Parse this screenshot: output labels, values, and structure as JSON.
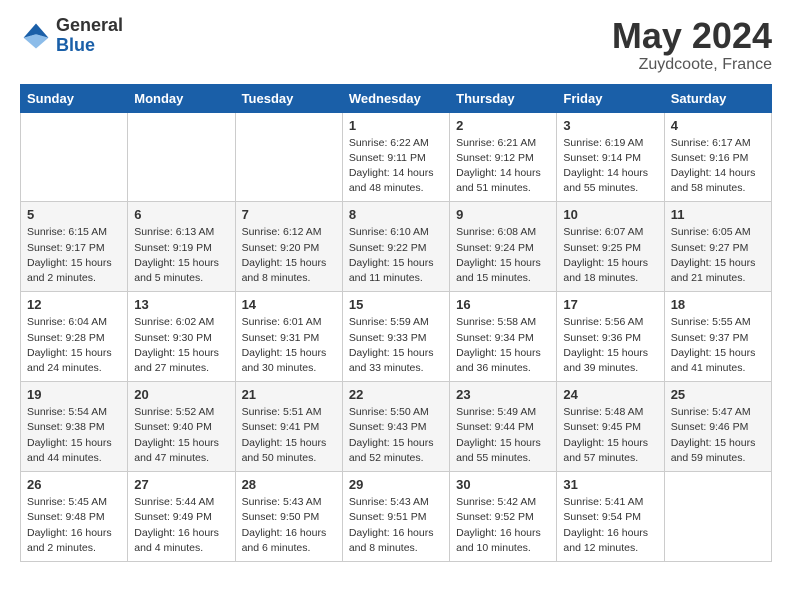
{
  "logo": {
    "general": "General",
    "blue": "Blue"
  },
  "header": {
    "title": "May 2024",
    "location": "Zuydcoote, France"
  },
  "weekdays": [
    "Sunday",
    "Monday",
    "Tuesday",
    "Wednesday",
    "Thursday",
    "Friday",
    "Saturday"
  ],
  "weeks": [
    [
      {
        "day": "",
        "info": ""
      },
      {
        "day": "",
        "info": ""
      },
      {
        "day": "",
        "info": ""
      },
      {
        "day": "1",
        "info": "Sunrise: 6:22 AM\nSunset: 9:11 PM\nDaylight: 14 hours\nand 48 minutes."
      },
      {
        "day": "2",
        "info": "Sunrise: 6:21 AM\nSunset: 9:12 PM\nDaylight: 14 hours\nand 51 minutes."
      },
      {
        "day": "3",
        "info": "Sunrise: 6:19 AM\nSunset: 9:14 PM\nDaylight: 14 hours\nand 55 minutes."
      },
      {
        "day": "4",
        "info": "Sunrise: 6:17 AM\nSunset: 9:16 PM\nDaylight: 14 hours\nand 58 minutes."
      }
    ],
    [
      {
        "day": "5",
        "info": "Sunrise: 6:15 AM\nSunset: 9:17 PM\nDaylight: 15 hours\nand 2 minutes."
      },
      {
        "day": "6",
        "info": "Sunrise: 6:13 AM\nSunset: 9:19 PM\nDaylight: 15 hours\nand 5 minutes."
      },
      {
        "day": "7",
        "info": "Sunrise: 6:12 AM\nSunset: 9:20 PM\nDaylight: 15 hours\nand 8 minutes."
      },
      {
        "day": "8",
        "info": "Sunrise: 6:10 AM\nSunset: 9:22 PM\nDaylight: 15 hours\nand 11 minutes."
      },
      {
        "day": "9",
        "info": "Sunrise: 6:08 AM\nSunset: 9:24 PM\nDaylight: 15 hours\nand 15 minutes."
      },
      {
        "day": "10",
        "info": "Sunrise: 6:07 AM\nSunset: 9:25 PM\nDaylight: 15 hours\nand 18 minutes."
      },
      {
        "day": "11",
        "info": "Sunrise: 6:05 AM\nSunset: 9:27 PM\nDaylight: 15 hours\nand 21 minutes."
      }
    ],
    [
      {
        "day": "12",
        "info": "Sunrise: 6:04 AM\nSunset: 9:28 PM\nDaylight: 15 hours\nand 24 minutes."
      },
      {
        "day": "13",
        "info": "Sunrise: 6:02 AM\nSunset: 9:30 PM\nDaylight: 15 hours\nand 27 minutes."
      },
      {
        "day": "14",
        "info": "Sunrise: 6:01 AM\nSunset: 9:31 PM\nDaylight: 15 hours\nand 30 minutes."
      },
      {
        "day": "15",
        "info": "Sunrise: 5:59 AM\nSunset: 9:33 PM\nDaylight: 15 hours\nand 33 minutes."
      },
      {
        "day": "16",
        "info": "Sunrise: 5:58 AM\nSunset: 9:34 PM\nDaylight: 15 hours\nand 36 minutes."
      },
      {
        "day": "17",
        "info": "Sunrise: 5:56 AM\nSunset: 9:36 PM\nDaylight: 15 hours\nand 39 minutes."
      },
      {
        "day": "18",
        "info": "Sunrise: 5:55 AM\nSunset: 9:37 PM\nDaylight: 15 hours\nand 41 minutes."
      }
    ],
    [
      {
        "day": "19",
        "info": "Sunrise: 5:54 AM\nSunset: 9:38 PM\nDaylight: 15 hours\nand 44 minutes."
      },
      {
        "day": "20",
        "info": "Sunrise: 5:52 AM\nSunset: 9:40 PM\nDaylight: 15 hours\nand 47 minutes."
      },
      {
        "day": "21",
        "info": "Sunrise: 5:51 AM\nSunset: 9:41 PM\nDaylight: 15 hours\nand 50 minutes."
      },
      {
        "day": "22",
        "info": "Sunrise: 5:50 AM\nSunset: 9:43 PM\nDaylight: 15 hours\nand 52 minutes."
      },
      {
        "day": "23",
        "info": "Sunrise: 5:49 AM\nSunset: 9:44 PM\nDaylight: 15 hours\nand 55 minutes."
      },
      {
        "day": "24",
        "info": "Sunrise: 5:48 AM\nSunset: 9:45 PM\nDaylight: 15 hours\nand 57 minutes."
      },
      {
        "day": "25",
        "info": "Sunrise: 5:47 AM\nSunset: 9:46 PM\nDaylight: 15 hours\nand 59 minutes."
      }
    ],
    [
      {
        "day": "26",
        "info": "Sunrise: 5:45 AM\nSunset: 9:48 PM\nDaylight: 16 hours\nand 2 minutes."
      },
      {
        "day": "27",
        "info": "Sunrise: 5:44 AM\nSunset: 9:49 PM\nDaylight: 16 hours\nand 4 minutes."
      },
      {
        "day": "28",
        "info": "Sunrise: 5:43 AM\nSunset: 9:50 PM\nDaylight: 16 hours\nand 6 minutes."
      },
      {
        "day": "29",
        "info": "Sunrise: 5:43 AM\nSunset: 9:51 PM\nDaylight: 16 hours\nand 8 minutes."
      },
      {
        "day": "30",
        "info": "Sunrise: 5:42 AM\nSunset: 9:52 PM\nDaylight: 16 hours\nand 10 minutes."
      },
      {
        "day": "31",
        "info": "Sunrise: 5:41 AM\nSunset: 9:54 PM\nDaylight: 16 hours\nand 12 minutes."
      },
      {
        "day": "",
        "info": ""
      }
    ]
  ]
}
